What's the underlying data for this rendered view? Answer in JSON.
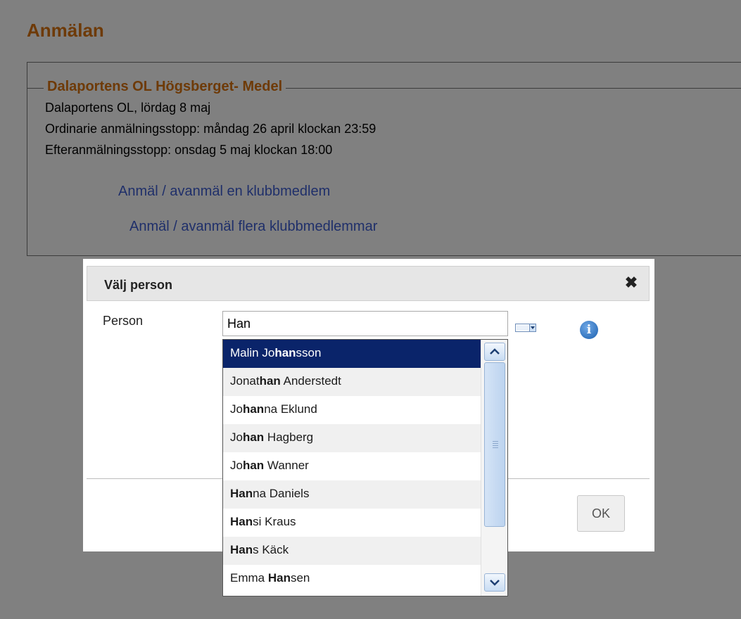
{
  "page": {
    "title": "Anmälan",
    "event": {
      "name": "Dalaportens OL Högsberget- Medel",
      "line1": "Dalaportens OL, lördag 8 maj",
      "line2": "Ordinarie anmälningsstopp: måndag 26 april klockan 23:59",
      "line3": "Efteranmälningsstopp: onsdag 5 maj klockan 18:00"
    },
    "links": {
      "single": "Anmäl / avanmäl en klubbmedlem",
      "multiple": "Anmäl / avanmäl flera klubbmedlemmar"
    }
  },
  "modal": {
    "title": "Välj person",
    "close_icon": "close-icon",
    "person_label": "Person",
    "person_value": "Han",
    "ok_label": "OK",
    "info_icon": "info-icon"
  },
  "dropdown": {
    "highlight": "han",
    "items": [
      "Malin Johansson",
      "Jonathan Anderstedt",
      "Johanna Eklund",
      "Johan Hagberg",
      "Johan Wanner",
      "Hanna Daniels",
      "Hansi Kraus",
      "Hans Käck",
      "Emma Hansen"
    ],
    "selected_index": 0
  },
  "colors": {
    "overlay": "#808080",
    "title": "#6e3a07",
    "link": "#1f2f6a",
    "selected": "#0a246a"
  }
}
